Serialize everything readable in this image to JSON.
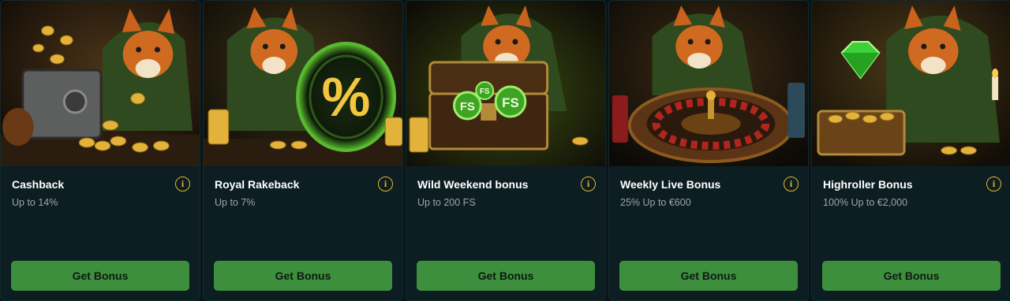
{
  "colors": {
    "background": "#071519",
    "card": "#0c1e22",
    "button": "#3d8f3e",
    "info_accent": "#e7b52a",
    "subtitle": "#9aa6a8"
  },
  "cards": [
    {
      "title": "Cashback",
      "subtitle": "Up to 14%",
      "button": "Get Bonus",
      "info_icon": "i",
      "art": "fox-with-safe-and-coins"
    },
    {
      "title": "Royal Rakeback",
      "subtitle": "Up to 7%",
      "button": "Get Bonus",
      "info_icon": "i",
      "art": "fox-with-percent-ring"
    },
    {
      "title": "Wild Weekend bonus",
      "subtitle": "Up to 200 FS",
      "button": "Get Bonus",
      "info_icon": "i",
      "art": "fox-with-treasure-chest-fs-coins"
    },
    {
      "title": "Weekly Live Bonus",
      "subtitle": "25% Up to €600",
      "button": "Get Bonus",
      "info_icon": "i",
      "art": "fox-with-roulette-wheel"
    },
    {
      "title": "Highroller Bonus",
      "subtitle": "100% Up to €2,000",
      "button": "Get Bonus",
      "info_icon": "i",
      "art": "fox-with-green-gem"
    }
  ]
}
